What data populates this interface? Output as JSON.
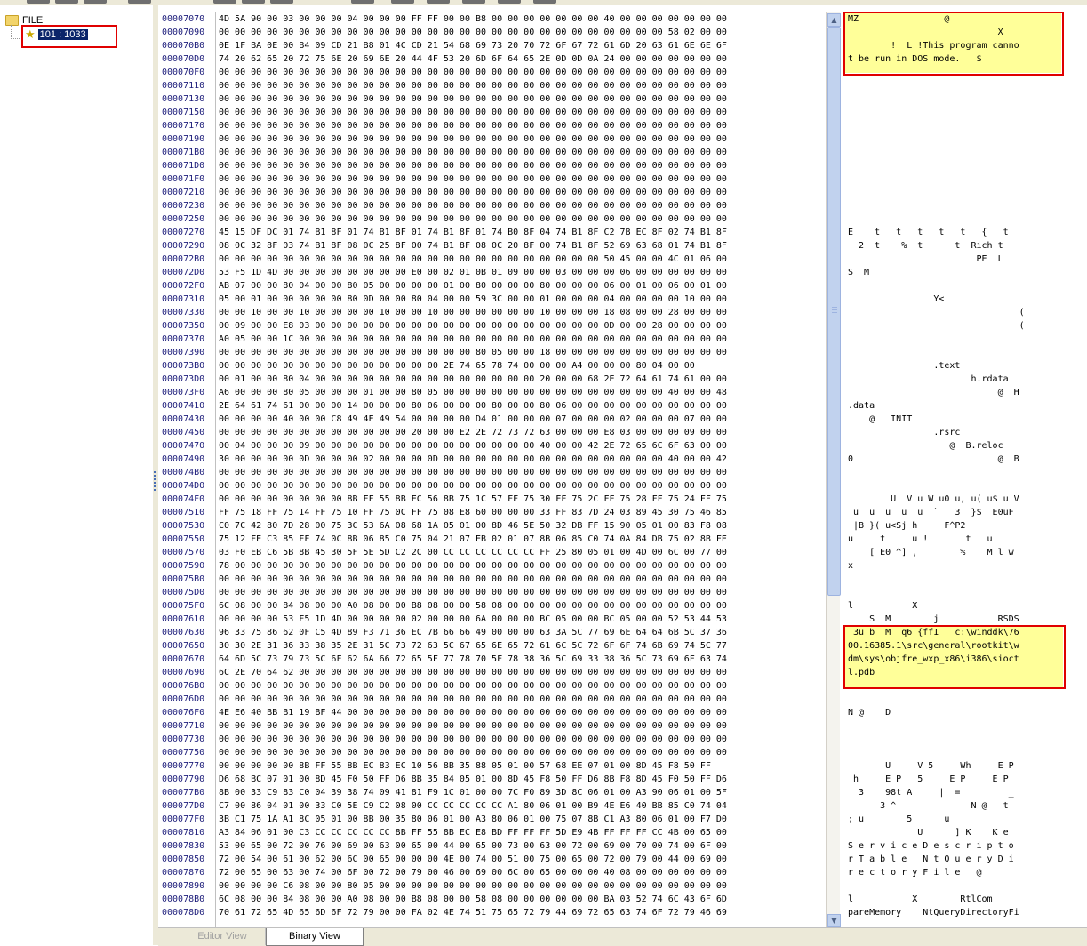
{
  "tree": {
    "root_label": "FILE",
    "child_label": "101 : 1033"
  },
  "tabs": {
    "editor_view": "Editor View",
    "binary_view": "Binary View"
  },
  "hex_rows": [
    {
      "addr": "00007070",
      "bytes": "4D 5A 90 00 03 00 00 00 04 00 00 00 FF FF 00 00 B8 00 00 00 00 00 00 00 40 00 00 00 00 00 00 00",
      "ascii": "MZ                @"
    },
    {
      "addr": "00007090",
      "bytes": "00 00 00 00 00 00 00 00 00 00 00 00 00 00 00 00 00 00 00 00 00 00 00 00 00 00 00 00 58 02 00 00",
      "ascii": "                            X"
    },
    {
      "addr": "000070B0",
      "bytes": "0E 1F BA 0E 00 B4 09 CD 21 B8 01 4C CD 21 54 68 69 73 20 70 72 6F 67 72 61 6D 20 63 61 6E 6E 6F",
      "ascii": "        !  L !This program canno"
    },
    {
      "addr": "000070D0",
      "bytes": "74 20 62 65 20 72 75 6E 20 69 6E 20 44 4F 53 20 6D 6F 64 65 2E 0D 0D 0A 24 00 00 00 00 00 00 00",
      "ascii": "t be run in DOS mode.   $"
    },
    {
      "addr": "000070F0",
      "bytes": "00 00 00 00 00 00 00 00 00 00 00 00 00 00 00 00 00 00 00 00 00 00 00 00 00 00 00 00 00 00 00 00",
      "ascii": ""
    },
    {
      "addr": "00007110",
      "bytes": "00 00 00 00 00 00 00 00 00 00 00 00 00 00 00 00 00 00 00 00 00 00 00 00 00 00 00 00 00 00 00 00",
      "ascii": ""
    },
    {
      "addr": "00007130",
      "bytes": "00 00 00 00 00 00 00 00 00 00 00 00 00 00 00 00 00 00 00 00 00 00 00 00 00 00 00 00 00 00 00 00",
      "ascii": ""
    },
    {
      "addr": "00007150",
      "bytes": "00 00 00 00 00 00 00 00 00 00 00 00 00 00 00 00 00 00 00 00 00 00 00 00 00 00 00 00 00 00 00 00",
      "ascii": ""
    },
    {
      "addr": "00007170",
      "bytes": "00 00 00 00 00 00 00 00 00 00 00 00 00 00 00 00 00 00 00 00 00 00 00 00 00 00 00 00 00 00 00 00",
      "ascii": ""
    },
    {
      "addr": "00007190",
      "bytes": "00 00 00 00 00 00 00 00 00 00 00 00 00 00 00 00 00 00 00 00 00 00 00 00 00 00 00 00 00 00 00 00",
      "ascii": ""
    },
    {
      "addr": "000071B0",
      "bytes": "00 00 00 00 00 00 00 00 00 00 00 00 00 00 00 00 00 00 00 00 00 00 00 00 00 00 00 00 00 00 00 00",
      "ascii": ""
    },
    {
      "addr": "000071D0",
      "bytes": "00 00 00 00 00 00 00 00 00 00 00 00 00 00 00 00 00 00 00 00 00 00 00 00 00 00 00 00 00 00 00 00",
      "ascii": ""
    },
    {
      "addr": "000071F0",
      "bytes": "00 00 00 00 00 00 00 00 00 00 00 00 00 00 00 00 00 00 00 00 00 00 00 00 00 00 00 00 00 00 00 00",
      "ascii": ""
    },
    {
      "addr": "00007210",
      "bytes": "00 00 00 00 00 00 00 00 00 00 00 00 00 00 00 00 00 00 00 00 00 00 00 00 00 00 00 00 00 00 00 00",
      "ascii": ""
    },
    {
      "addr": "00007230",
      "bytes": "00 00 00 00 00 00 00 00 00 00 00 00 00 00 00 00 00 00 00 00 00 00 00 00 00 00 00 00 00 00 00 00",
      "ascii": ""
    },
    {
      "addr": "00007250",
      "bytes": "00 00 00 00 00 00 00 00 00 00 00 00 00 00 00 00 00 00 00 00 00 00 00 00 00 00 00 00 00 00 00 00",
      "ascii": ""
    },
    {
      "addr": "00007270",
      "bytes": "45 15 DF DC 01 74 B1 8F 01 74 B1 8F 01 74 B1 8F 01 74 B0 8F 04 74 B1 8F C2 7B EC 8F 02 74 B1 8F",
      "ascii": "E    t   t   t   t   t   {   t"
    },
    {
      "addr": "00007290",
      "bytes": "08 0C 32 8F 03 74 B1 8F 08 0C 25 8F 00 74 B1 8F 08 0C 20 8F 00 74 B1 8F 52 69 63 68 01 74 B1 8F",
      "ascii": "  2  t    %  t      t  Rich t"
    },
    {
      "addr": "000072B0",
      "bytes": "00 00 00 00 00 00 00 00 00 00 00 00 00 00 00 00 00 00 00 00 00 00 00 00 50 45 00 00 4C 01 06 00",
      "ascii": "                        PE  L"
    },
    {
      "addr": "000072D0",
      "bytes": "53 F5 1D 4D 00 00 00 00 00 00 00 00 E0 00 02 01 0B 01 09 00 00 03 00 00 00 06 00 00 00 00 00 00",
      "ascii": "S  M"
    },
    {
      "addr": "000072F0",
      "bytes": "AB 07 00 00 80 04 00 00 80 05 00 00 00 00 01 00 80 00 00 00 80 00 00 00 06 00 01 00 06 00 01 00",
      "ascii": ""
    },
    {
      "addr": "00007310",
      "bytes": "05 00 01 00 00 00 00 00 80 0D 00 00 80 04 00 00 59 3C 00 00 01 00 00 00 04 00 00 00 00 10 00 00",
      "ascii": "                Y<"
    },
    {
      "addr": "00007330",
      "bytes": "00 00 10 00 00 10 00 00 00 00 10 00 00 10 00 00 00 00 00 00 10 00 00 00 18 08 00 00 28 00 00 00",
      "ascii": "                                ("
    },
    {
      "addr": "00007350",
      "bytes": "00 09 00 00 E8 03 00 00 00 00 00 00 00 00 00 00 00 00 00 00 00 00 00 00 0D 00 00 28 00 00 00 00",
      "ascii": "                                ("
    },
    {
      "addr": "00007370",
      "bytes": "A0 05 00 00 1C 00 00 00 00 00 00 00 00 00 00 00 00 00 00 00 00 00 00 00 00 00 00 00 00 00 00 00",
      "ascii": ""
    },
    {
      "addr": "00007390",
      "bytes": "00 00 00 00 00 00 00 00 00 00 00 00 00 00 00 00 80 05 00 00 18 00 00 00 00 00 00 00 00 00 00 00",
      "ascii": ""
    },
    {
      "addr": "000073B0",
      "bytes": "00 00 00 00 00 00 00 00 00 00 00 00 00 00 2E 74 65 78 74 00 00 00 A4 00 00 00 80 04 00 00",
      "ascii": "                .text"
    },
    {
      "addr": "000073D0",
      "bytes": "00 01 00 00 80 04 00 00 00 00 00 00 00 00 00 00 00 00 00 00 20 00 00 68 2E 72 64 61 74 61 00 00",
      "ascii": "                       h.rdata"
    },
    {
      "addr": "000073F0",
      "bytes": "A6 00 00 00 80 05 00 00 00 01 00 00 80 05 00 00 00 00 00 00 00 00 00 00 00 00 00 00 40 00 00 48",
      "ascii": "                            @  H"
    },
    {
      "addr": "00007410",
      "bytes": "2E 64 61 74 61 00 00 00 14 00 00 00 80 06 00 00 00 80 00 00 80 06 00 00 00 00 00 00 00 00 00 00",
      "ascii": ".data"
    },
    {
      "addr": "00007430",
      "bytes": "00 00 00 00 40 00 00 C8 49 4E 49 54 00 00 00 00 D4 01 00 00 00 07 00 00 00 02 00 00 00 07 00 00",
      "ascii": "    @   INIT"
    },
    {
      "addr": "00007450",
      "bytes": "00 00 00 00 00 00 00 00 00 00 00 00 20 00 00 E2 2E 72 73 72 63 00 00 00 E8 03 00 00 00 09 00 00",
      "ascii": "                .rsrc"
    },
    {
      "addr": "00007470",
      "bytes": "00 04 00 00 00 09 00 00 00 00 00 00 00 00 00 00 00 00 00 00 40 00 00 42 2E 72 65 6C 6F 63 00 00",
      "ascii": "                   @  B.reloc"
    },
    {
      "addr": "00007490",
      "bytes": "30 00 00 00 00 0D 00 00 00 02 00 00 00 0D 00 00 00 00 00 00 00 00 00 00 00 00 00 00 40 00 00 42",
      "ascii": "0                           @  B"
    },
    {
      "addr": "000074B0",
      "bytes": "00 00 00 00 00 00 00 00 00 00 00 00 00 00 00 00 00 00 00 00 00 00 00 00 00 00 00 00 00 00 00 00",
      "ascii": ""
    },
    {
      "addr": "000074D0",
      "bytes": "00 00 00 00 00 00 00 00 00 00 00 00 00 00 00 00 00 00 00 00 00 00 00 00 00 00 00 00 00 00 00 00",
      "ascii": ""
    },
    {
      "addr": "000074F0",
      "bytes": "00 00 00 00 00 00 00 00 8B FF 55 8B EC 56 8B 75 1C 57 FF 75 30 FF 75 2C FF 75 28 FF 75 24 FF 75",
      "ascii": "        U  V u W u0 u, u( u$ u V"
    },
    {
      "addr": "00007510",
      "bytes": "FF 75 18 FF 75 14 FF 75 10 FF 75 0C FF 75 08 E8 60 00 00 00 33 FF 83 7D 24 03 89 45 30 75 46 85",
      "ascii": " u  u  u  u  u  `   3  }$  E0uF"
    },
    {
      "addr": "00007530",
      "bytes": "C0 7C 42 80 7D 28 00 75 3C 53 6A 08 68 1A 05 01 00 8D 46 5E 50 32 DB FF 15 90 05 01 00 83 F8 08",
      "ascii": " |B }( u<Sj h     F^P2"
    },
    {
      "addr": "00007550",
      "bytes": "75 12 FE C3 85 FF 74 0C 8B 06 85 C0 75 04 21 07 EB 02 01 07 8B 06 85 C0 74 0A 84 DB 75 02 8B FE",
      "ascii": "u     t     u !       t   u"
    },
    {
      "addr": "00007570",
      "bytes": "03 F0 EB C6 5B 8B 45 30 5F 5E 5D C2 2C 00 CC CC CC CC CC CC FF 25 80 05 01 00 4D 00 6C 00 77 00",
      "ascii": "    [ E0_^] ,        %    M l w"
    },
    {
      "addr": "00007590",
      "bytes": "78 00 00 00 00 00 00 00 00 00 00 00 00 00 00 00 00 00 00 00 00 00 00 00 00 00 00 00 00 00 00 00",
      "ascii": "x"
    },
    {
      "addr": "000075B0",
      "bytes": "00 00 00 00 00 00 00 00 00 00 00 00 00 00 00 00 00 00 00 00 00 00 00 00 00 00 00 00 00 00 00 00",
      "ascii": ""
    },
    {
      "addr": "000075D0",
      "bytes": "00 00 00 00 00 00 00 00 00 00 00 00 00 00 00 00 00 00 00 00 00 00 00 00 00 00 00 00 00 00 00 00",
      "ascii": ""
    },
    {
      "addr": "000075F0",
      "bytes": "6C 08 00 00 84 08 00 00 A0 08 00 00 B8 08 00 00 58 08 00 00 00 00 00 00 00 00 00 00 00 00 00 00",
      "ascii": "l           X"
    },
    {
      "addr": "00007610",
      "bytes": "00 00 00 00 53 F5 1D 4D 00 00 00 00 02 00 00 00 6A 00 00 00 BC 05 00 00 BC 05 00 00 52 53 44 53",
      "ascii": "    S  M        j           RSDS"
    },
    {
      "addr": "00007630",
      "bytes": "96 33 75 86 62 0F C5 4D 89 F3 71 36 EC 7B 66 66 49 00 00 00 63 3A 5C 77 69 6E 64 64 6B 5C 37 36",
      "ascii": " 3u b  M  q6 {ffI   c:\\winddk\\76"
    },
    {
      "addr": "00007650",
      "bytes": "30 30 2E 31 36 33 38 35 2E 31 5C 73 72 63 5C 67 65 6E 65 72 61 6C 5C 72 6F 6F 74 6B 69 74 5C 77",
      "ascii": "00.16385.1\\src\\general\\rootkit\\w"
    },
    {
      "addr": "00007670",
      "bytes": "64 6D 5C 73 79 73 5C 6F 62 6A 66 72 65 5F 77 78 70 5F 78 38 36 5C 69 33 38 36 5C 73 69 6F 63 74",
      "ascii": "dm\\sys\\objfre_wxp_x86\\i386\\sioct"
    },
    {
      "addr": "00007690",
      "bytes": "6C 2E 70 64 62 00 00 00 00 00 00 00 00 00 00 00 00 00 00 00 00 00 00 00 00 00 00 00 00 00 00 00",
      "ascii": "l.pdb"
    },
    {
      "addr": "000076B0",
      "bytes": "00 00 00 00 00 00 00 00 00 00 00 00 00 00 00 00 00 00 00 00 00 00 00 00 00 00 00 00 00 00 00 00",
      "ascii": ""
    },
    {
      "addr": "000076D0",
      "bytes": "00 00 00 00 00 00 00 00 00 00 00 00 00 00 00 00 00 00 00 00 00 00 00 00 00 00 00 00 00 00 00 00",
      "ascii": ""
    },
    {
      "addr": "000076F0",
      "bytes": "4E E6 40 BB B1 19 BF 44 00 00 00 00 00 00 00 00 00 00 00 00 00 00 00 00 00 00 00 00 00 00 00 00",
      "ascii": "N @    D"
    },
    {
      "addr": "00007710",
      "bytes": "00 00 00 00 00 00 00 00 00 00 00 00 00 00 00 00 00 00 00 00 00 00 00 00 00 00 00 00 00 00 00 00",
      "ascii": ""
    },
    {
      "addr": "00007730",
      "bytes": "00 00 00 00 00 00 00 00 00 00 00 00 00 00 00 00 00 00 00 00 00 00 00 00 00 00 00 00 00 00 00 00",
      "ascii": ""
    },
    {
      "addr": "00007750",
      "bytes": "00 00 00 00 00 00 00 00 00 00 00 00 00 00 00 00 00 00 00 00 00 00 00 00 00 00 00 00 00 00 00 00",
      "ascii": ""
    },
    {
      "addr": "00007770",
      "bytes": "00 00 00 00 00 8B FF 55 8B EC 83 EC 10 56 8B 35 88 05 01 00 57 68 EE 07 01 00 8D 45 F8 50 FF",
      "ascii": "       U     V 5     Wh     E P"
    },
    {
      "addr": "00007790",
      "bytes": "D6 68 BC 07 01 00 8D 45 F0 50 FF D6 8B 35 84 05 01 00 8D 45 F8 50 FF D6 8B F8 8D 45 F0 50 FF D6",
      "ascii": " h     E P   5     E P     E P"
    },
    {
      "addr": "000077B0",
      "bytes": "8B 00 33 C9 83 C0 04 39 38 74 09 41 81 F9 1C 01 00 00 7C F0 89 3D 8C 06 01 00 A3 90 06 01 00 5F",
      "ascii": "  3    98t A     |  =         _"
    },
    {
      "addr": "000077D0",
      "bytes": "C7 00 86 04 01 00 33 C0 5E C9 C2 08 00 CC CC CC CC CC A1 80 06 01 00 B9 4E E6 40 BB 85 C0 74 04",
      "ascii": "      3 ^              N @   t"
    },
    {
      "addr": "000077F0",
      "bytes": "3B C1 75 1A A1 8C 05 01 00 8B 00 35 80 06 01 00 A3 80 06 01 00 75 07 8B C1 A3 80 06 01 00 F7 D0",
      "ascii": "; u        5      u"
    },
    {
      "addr": "00007810",
      "bytes": "A3 84 06 01 00 C3 CC CC CC CC CC 8B FF 55 8B EC E8 BD FF FF FF 5D E9 4B FF FF FF CC 4B 00 65 00",
      "ascii": "             U      ] K    K e"
    },
    {
      "addr": "00007830",
      "bytes": "53 00 65 00 72 00 76 00 69 00 63 00 65 00 44 00 65 00 73 00 63 00 72 00 69 00 70 00 74 00 6F 00",
      "ascii": "S e r v i c e D e s c r i p t o"
    },
    {
      "addr": "00007850",
      "bytes": "72 00 54 00 61 00 62 00 6C 00 65 00 00 00 4E 00 74 00 51 00 75 00 65 00 72 00 79 00 44 00 69 00",
      "ascii": "r T a b l e   N t Q u e r y D i"
    },
    {
      "addr": "00007870",
      "bytes": "72 00 65 00 63 00 74 00 6F 00 72 00 79 00 46 00 69 00 6C 00 65 00 00 00 40 08 00 00 00 00 00 00",
      "ascii": "r e c t o r y F i l e   @"
    },
    {
      "addr": "00007890",
      "bytes": "00 00 00 00 C6 08 00 00 80 05 00 00 00 00 00 00 00 00 00 00 00 00 00 00 00 00 00 00 00 00 00 00",
      "ascii": ""
    },
    {
      "addr": "000078B0",
      "bytes": "6C 08 00 00 84 08 00 00 A0 08 00 00 B8 08 00 00 58 08 00 00 00 00 00 00 BA 03 52 74 6C 43 6F 6D",
      "ascii": "l           X        RtlCom"
    },
    {
      "addr": "000078D0",
      "bytes": "70 61 72 65 4D 65 6D 6F 72 79 00 00 FA 02 4E 74 51 75 65 72 79 44 69 72 65 63 74 6F 72 79 46 69",
      "ascii": "pareMemory    NtQueryDirectoryFi"
    }
  ]
}
